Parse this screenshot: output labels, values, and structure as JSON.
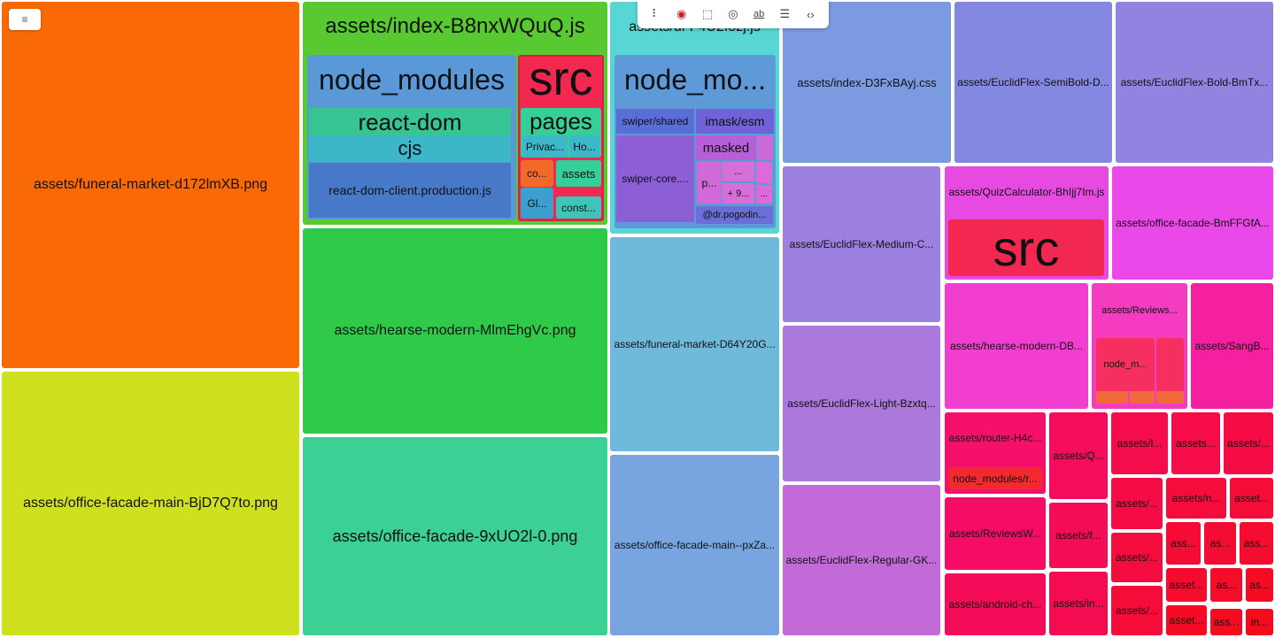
{
  "ui": {
    "menu_icon": "hamburger-icon",
    "menu_glyph": "≡"
  },
  "toolbar": {
    "icons": [
      "drag-handle-icon",
      "stop-record-icon",
      "select-element-icon",
      "eye-icon",
      "text-edit-icon",
      "comment-icon",
      "code-file-icon"
    ],
    "glyphs": [
      "⠇",
      "◉",
      "⬚",
      "◎",
      "ab",
      "☰",
      "‹›"
    ]
  },
  "colors": {
    "funeral_market": "#f96a06",
    "office_facade_main": "#cfe01f",
    "index_js": "#58c930",
    "hearse_modern": "#30ca4a",
    "office_facade_png": "#3cd095",
    "ui_js": "#57d6d3",
    "src_red": "#f22850"
  },
  "blocks": {
    "funeral_market_png": "assets/funeral-market-d172lmXB.png",
    "office_facade_main_png": "assets/office-facade-main-BjD7Q7to.png",
    "index_js": "assets/index-B8nxWQuQ.js",
    "hearse_modern_png": "assets/hearse-modern-MlmEhgVc.png",
    "office_facade_png": "assets/office-facade-9xUO2l-0.png",
    "ui_js": "assets/ui-F4U2f8zj.js",
    "funeral_market_webp": "assets/funeral-market-D64Y20G...",
    "office_facade_main_webp": "assets/office-facade-main--pxZa...",
    "index_css": "assets/index-D3FxBAyj.css",
    "euclid_semibold": "assets/EuclidFlex-SemiBold-D...",
    "euclid_bold": "assets/EuclidFlex-Bold-BmTx...",
    "euclid_medium": "assets/EuclidFlex-Medium-C...",
    "euclid_light": "assets/EuclidFlex-Light-Bzxtq...",
    "euclid_regular": "assets/EuclidFlex-Regular-GK...",
    "quiz_calculator": "assets/QuizCalculator-BhIjj7Im.js",
    "office_facade_small": "assets/office-facade-BmFFGfA...",
    "hearse_modern_small": "assets/hearse-modern-DB...",
    "reviews": "assets/Reviews...",
    "sang": "assets/SangB...",
    "router": "assets/router-H4c...",
    "router_child": "node_modules/r...",
    "reviews_w": "assets/ReviewsW...",
    "android": "assets/android-ch...",
    "q": "assets/Q...",
    "f": "assets/f...",
    "in": "assets/in...",
    "l": "assets/l...",
    "s1": "assets...",
    "s2": "assets/...",
    "s3": "assets/...",
    "n": "assets/n...",
    "a1": "asset...",
    "s4": "assets/...",
    "ass1": "ass...",
    "as1": "as...",
    "ass2": "ass...",
    "s5": "assets/...",
    "asset2": "asset...",
    "as2": "as...",
    "as3": "as...",
    "asset3": "asset...",
    "ass3": "ass...",
    "in2": "in..."
  },
  "index_children": {
    "node_modules": "node_modules",
    "react_dom": "react-dom",
    "cjs": "cjs",
    "react_dom_client": "react-dom-client.production.js",
    "src": "src",
    "pages": "pages",
    "privacy": "Privac...",
    "ho": "Ho...",
    "co": "co...",
    "assets": "assets",
    "gl": "Gl...",
    "const": "const..."
  },
  "ui_children": {
    "node_modules": "node_mo...",
    "swiper_shared": "swiper/shared",
    "imask_esm": "imask/esm",
    "swiper_core": "swiper-core....",
    "masked": "masked",
    "p": "p...",
    "dots": "...",
    "plus": "+ 9...",
    "dots2": "...",
    "pogodin": "@dr.pogodin..."
  },
  "quiz_children": {
    "src": "src"
  },
  "reviews_children": {
    "node_modules": "node_m..."
  }
}
